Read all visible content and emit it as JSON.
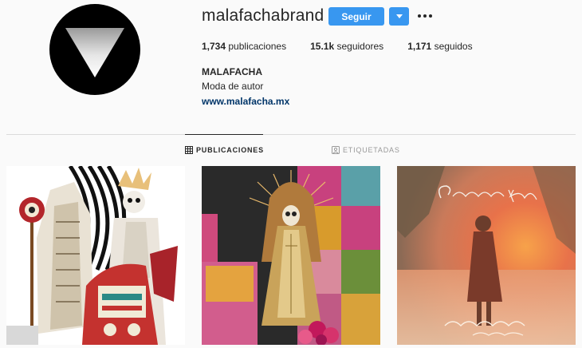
{
  "profile": {
    "username": "malafachabrand",
    "follow_label": "Seguir",
    "stats": {
      "posts_count": "1,734",
      "posts_label": "publicaciones",
      "followers_count": "15.1k",
      "followers_label": "seguidores",
      "following_count": "1,171",
      "following_label": "seguidos"
    },
    "full_name": "MALAFACHA",
    "bio": "Moda de autor",
    "website": "www.malafacha.mx"
  },
  "tabs": [
    {
      "label": "PUBLICACIONES",
      "active": true,
      "icon": "grid-icon"
    },
    {
      "label": "ETIQUETADAS",
      "active": false,
      "icon": "tag-icon"
    }
  ],
  "colors": {
    "primary_button": "#3897f0",
    "link": "#003569",
    "divider": "#dbdbdb"
  }
}
